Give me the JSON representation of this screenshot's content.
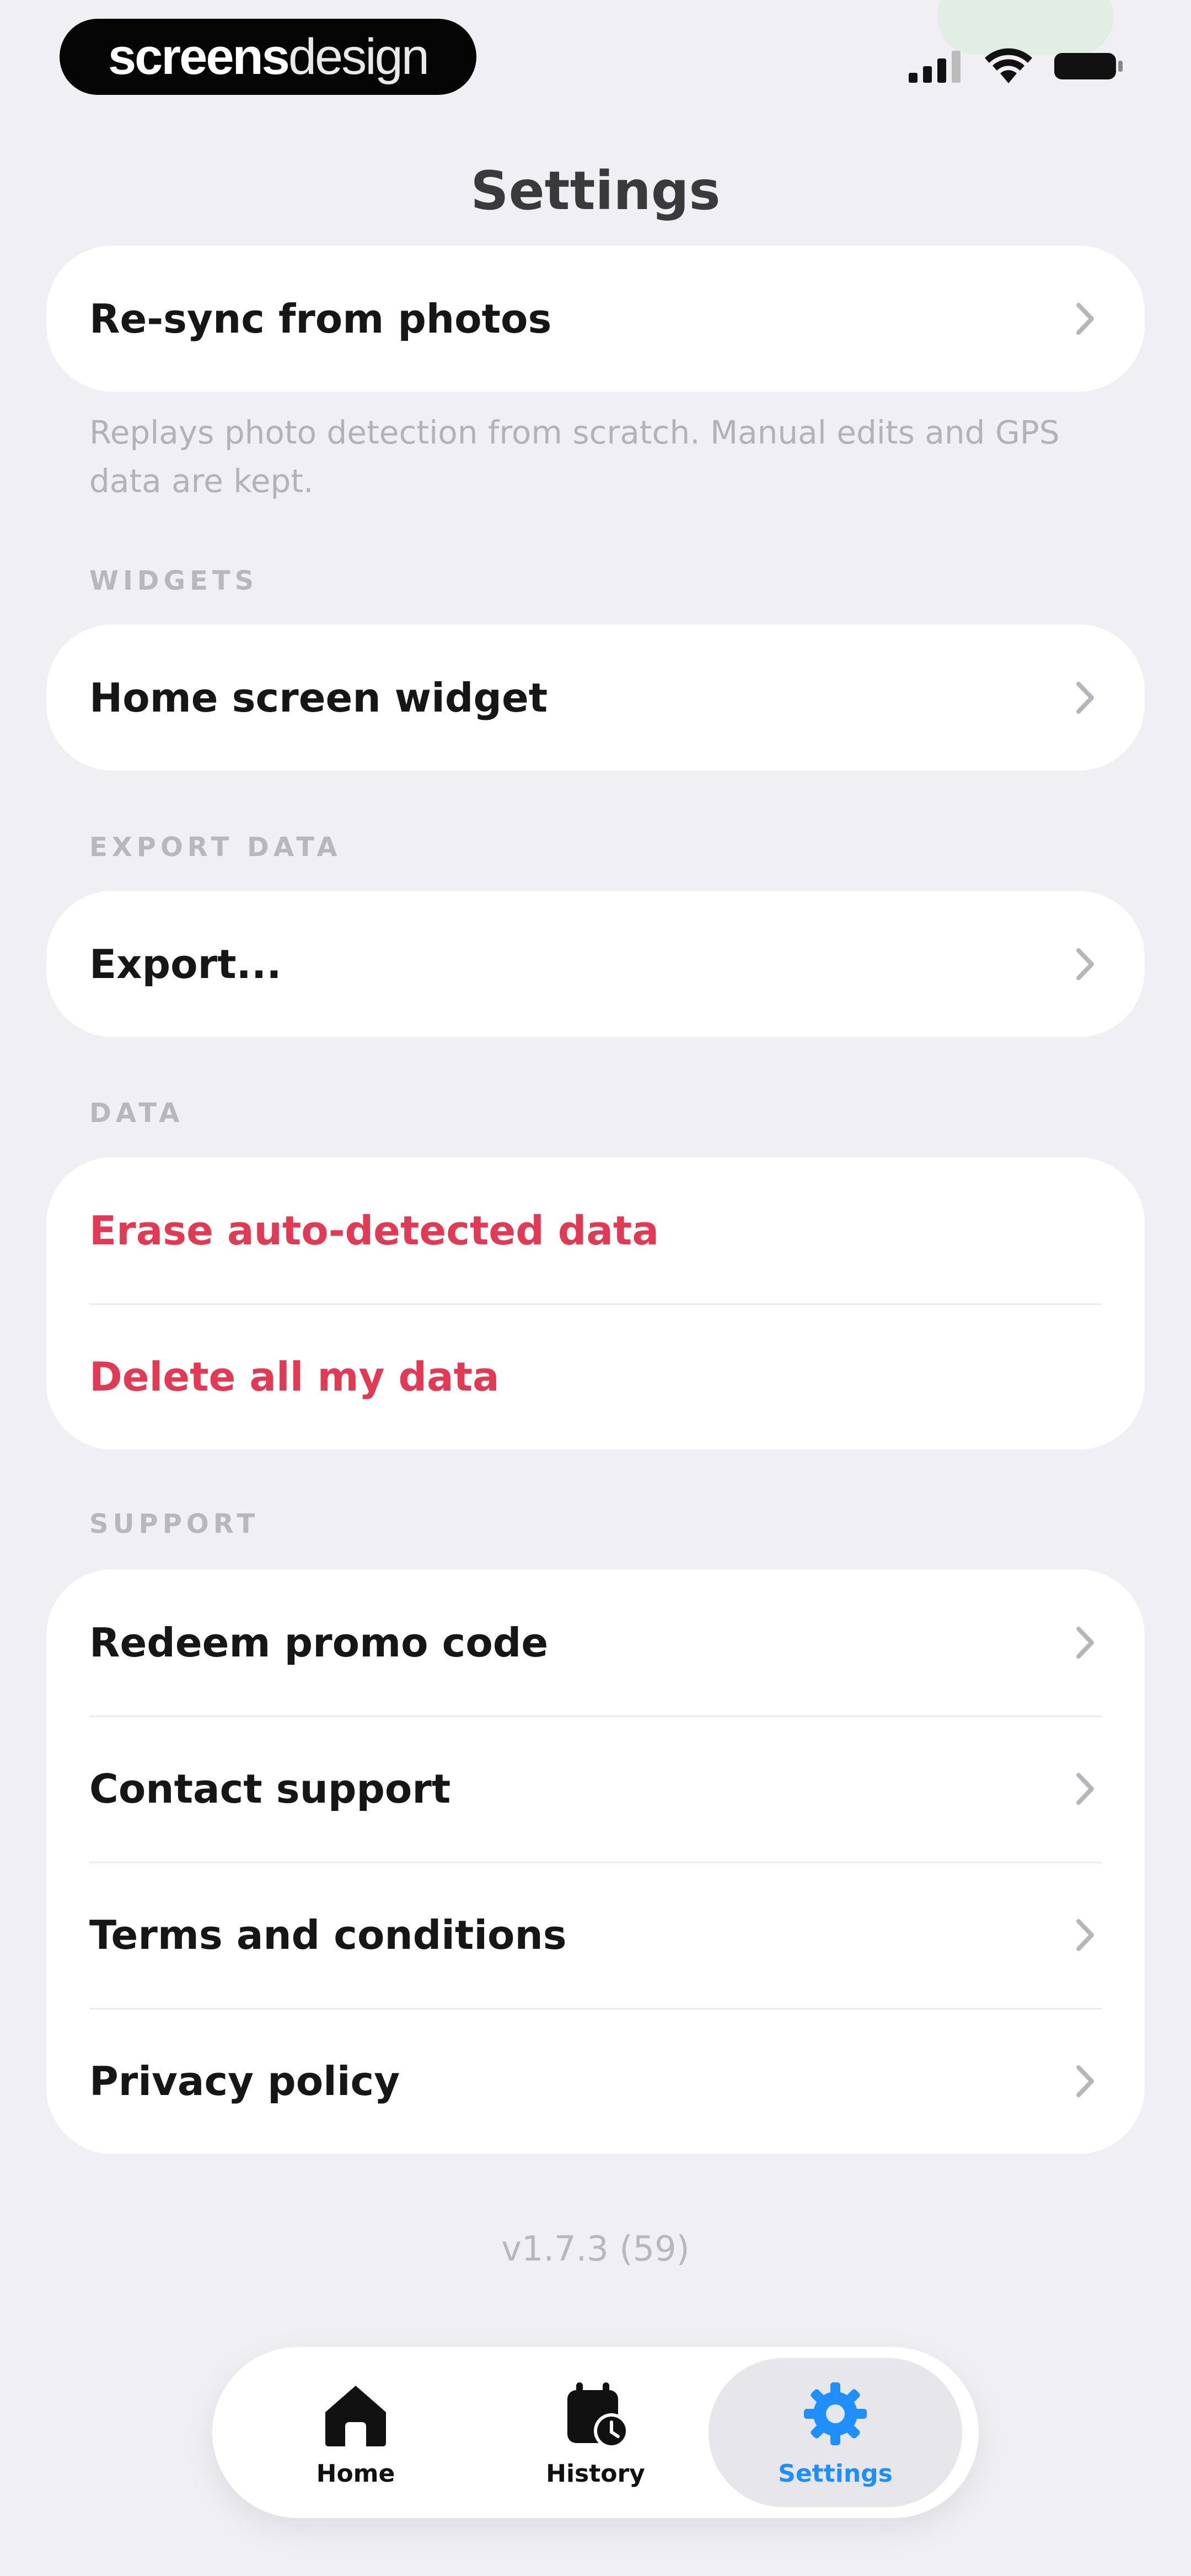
{
  "brand": {
    "bold": "screens",
    "light": "design"
  },
  "header": {
    "title": "Settings"
  },
  "resync": {
    "label": "Re-sync from photos",
    "hint": "Replays photo detection from scratch. Manual edits and GPS data are kept."
  },
  "widgets": {
    "header": "WIDGETS",
    "items": [
      {
        "label": "Home screen widget"
      }
    ]
  },
  "export": {
    "header": "EXPORT DATA",
    "items": [
      {
        "label": "Export..."
      }
    ]
  },
  "data": {
    "header": "DATA",
    "items": [
      {
        "label": "Erase auto-detected data"
      },
      {
        "label": "Delete all my data"
      }
    ]
  },
  "support": {
    "header": "SUPPORT",
    "items": [
      {
        "label": "Redeem promo code"
      },
      {
        "label": "Contact support"
      },
      {
        "label": "Terms and conditions"
      },
      {
        "label": "Privacy policy"
      }
    ]
  },
  "footer": {
    "version": "v1.7.3 (59)"
  },
  "tabs": [
    {
      "label": "Home",
      "icon": "home-icon"
    },
    {
      "label": "History",
      "icon": "calendar-clock-icon"
    },
    {
      "label": "Settings",
      "icon": "gear-icon",
      "active": true
    }
  ],
  "colors": {
    "accent": "#1f8fff",
    "danger": "#e23a55",
    "background": "#efeff4"
  }
}
